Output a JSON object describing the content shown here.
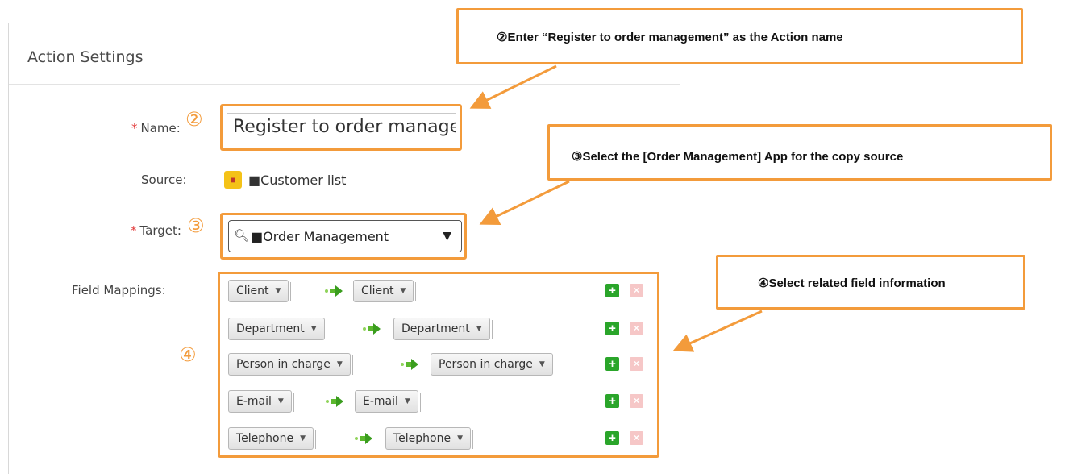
{
  "panel": {
    "title": "Action Settings"
  },
  "form": {
    "name_label": "Name:",
    "name_value": "Register to order manage",
    "source_label": "Source:",
    "source_value": "■Customer list",
    "target_label": "Target:",
    "target_value": "■Order Management",
    "mappings_label": "Field Mappings:",
    "required_mark": "*",
    "mappings": [
      {
        "source": "Client",
        "target": "Client"
      },
      {
        "source": "Department",
        "target": "Department"
      },
      {
        "source": "Person in charge",
        "target": "Person in charge"
      },
      {
        "source": "E-mail",
        "target": "E-mail"
      },
      {
        "source": "Telephone",
        "target": "Telephone"
      }
    ]
  },
  "markers": {
    "name": "②",
    "target": "③",
    "mappings": "④"
  },
  "callouts": {
    "step2": "②Enter “Register to order management” as the Action name",
    "step3": "③Select the [Order Management] App for the copy source",
    "step4": "④Select related field information"
  },
  "icons": {
    "app": "app-icon",
    "search": "search-icon",
    "caret": "caret-down-icon",
    "arrow": "green-arrow-icon",
    "add": "plus-icon",
    "remove": "close-icon"
  },
  "colors": {
    "highlight": "#f39b3b",
    "add": "#2aa52a",
    "remove": "#f6c7c7",
    "required": "#e23b3b"
  }
}
